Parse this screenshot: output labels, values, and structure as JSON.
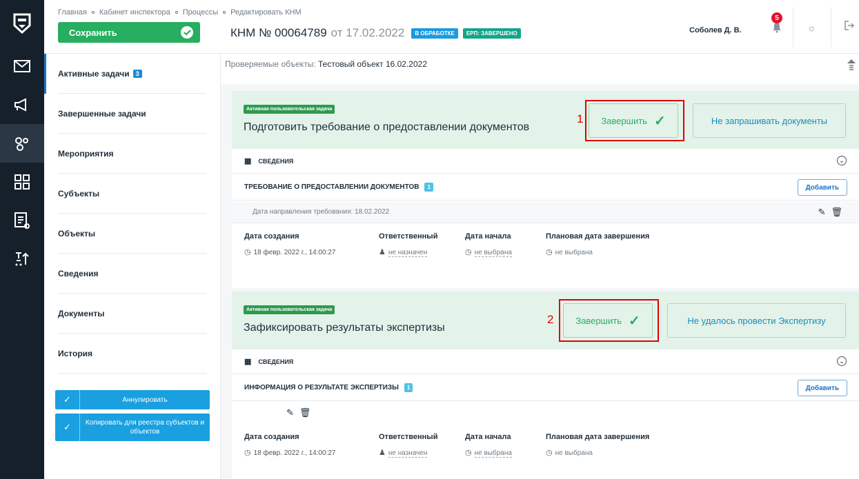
{
  "breadcrumbs": [
    "Главная",
    "Кабинет инспектора",
    "Процессы",
    "Редактировать КНМ"
  ],
  "header": {
    "save_label": "Сохранить",
    "title_number": "КНМ № 00064789",
    "title_date": "от 17.02.2022",
    "badge1": "в обработке",
    "badge2": "ЕРП: завершено",
    "user": "Соболев Д. В.",
    "notifications": "5"
  },
  "colors": {
    "accent": "#1a8cd8",
    "success": "#27ae60",
    "badge_blue": "#1a9be0",
    "badge_teal": "#13a589",
    "rail": "#15202b"
  },
  "rail_icons": [
    "logo-icon",
    "mail-icon",
    "megaphone-icon",
    "gears-icon",
    "grid-icon",
    "report-icon",
    "sort-icon"
  ],
  "sidebar": {
    "items": [
      {
        "label": "Активные задачи",
        "count": "3"
      },
      {
        "label": "Завершенные задачи"
      },
      {
        "label": "Мероприятия"
      },
      {
        "label": "Субъекты"
      },
      {
        "label": "Объекты"
      },
      {
        "label": "Сведения"
      },
      {
        "label": "Документы"
      },
      {
        "label": "История"
      }
    ],
    "annul_label": "Аннулировать",
    "copy_label": "Копировать для реестра субъектов и объектов"
  },
  "objects": {
    "label": "Проверяемые объекты:",
    "value": "Тестовый объект 16.02.2022"
  },
  "tasks": [
    {
      "tag": "Активная пользовательская задача",
      "title": "Подготовить требование о предоставлении документов",
      "finish_label": "Завершить",
      "alt_label": "Не запрашивать документы",
      "marker": "1",
      "info_label": "Сведения",
      "section_title": "ТРЕБОВАНИЕ О ПРЕДОСТАВЛЕНИИ ДОКУМЕНТОВ",
      "section_count": "1",
      "add_label": "Добавить",
      "doc_row": "Дата направления требования: 18.02.2022",
      "fields": [
        {
          "label": "Дата создания",
          "value": "18 февр. 2022 г., 14:00:27"
        },
        {
          "label": "Ответственный",
          "value": "не назначен"
        },
        {
          "label": "Дата начала",
          "value": "не выбрана"
        },
        {
          "label": "Плановая дата завершения",
          "value": "не выбрана"
        }
      ]
    },
    {
      "tag": "Активная пользовательская задача",
      "title": "Зафиксировать результаты экспертизы",
      "finish_label": "Завершить",
      "alt_label": "Не удалось провести Экспертизу",
      "marker": "2",
      "info_label": "Сведения",
      "section_title": "ИНФОРМАЦИЯ О РЕЗУЛЬТАТЕ ЭКСПЕРТИЗЫ",
      "section_count": "1",
      "add_label": "Добавить",
      "fields": [
        {
          "label": "Дата создания",
          "value": "18 февр. 2022 г., 14:00:27"
        },
        {
          "label": "Ответственный",
          "value": "не назначен"
        },
        {
          "label": "Дата начала",
          "value": "не выбрана"
        },
        {
          "label": "Плановая дата завершения",
          "value": "не выбрана"
        }
      ]
    }
  ]
}
